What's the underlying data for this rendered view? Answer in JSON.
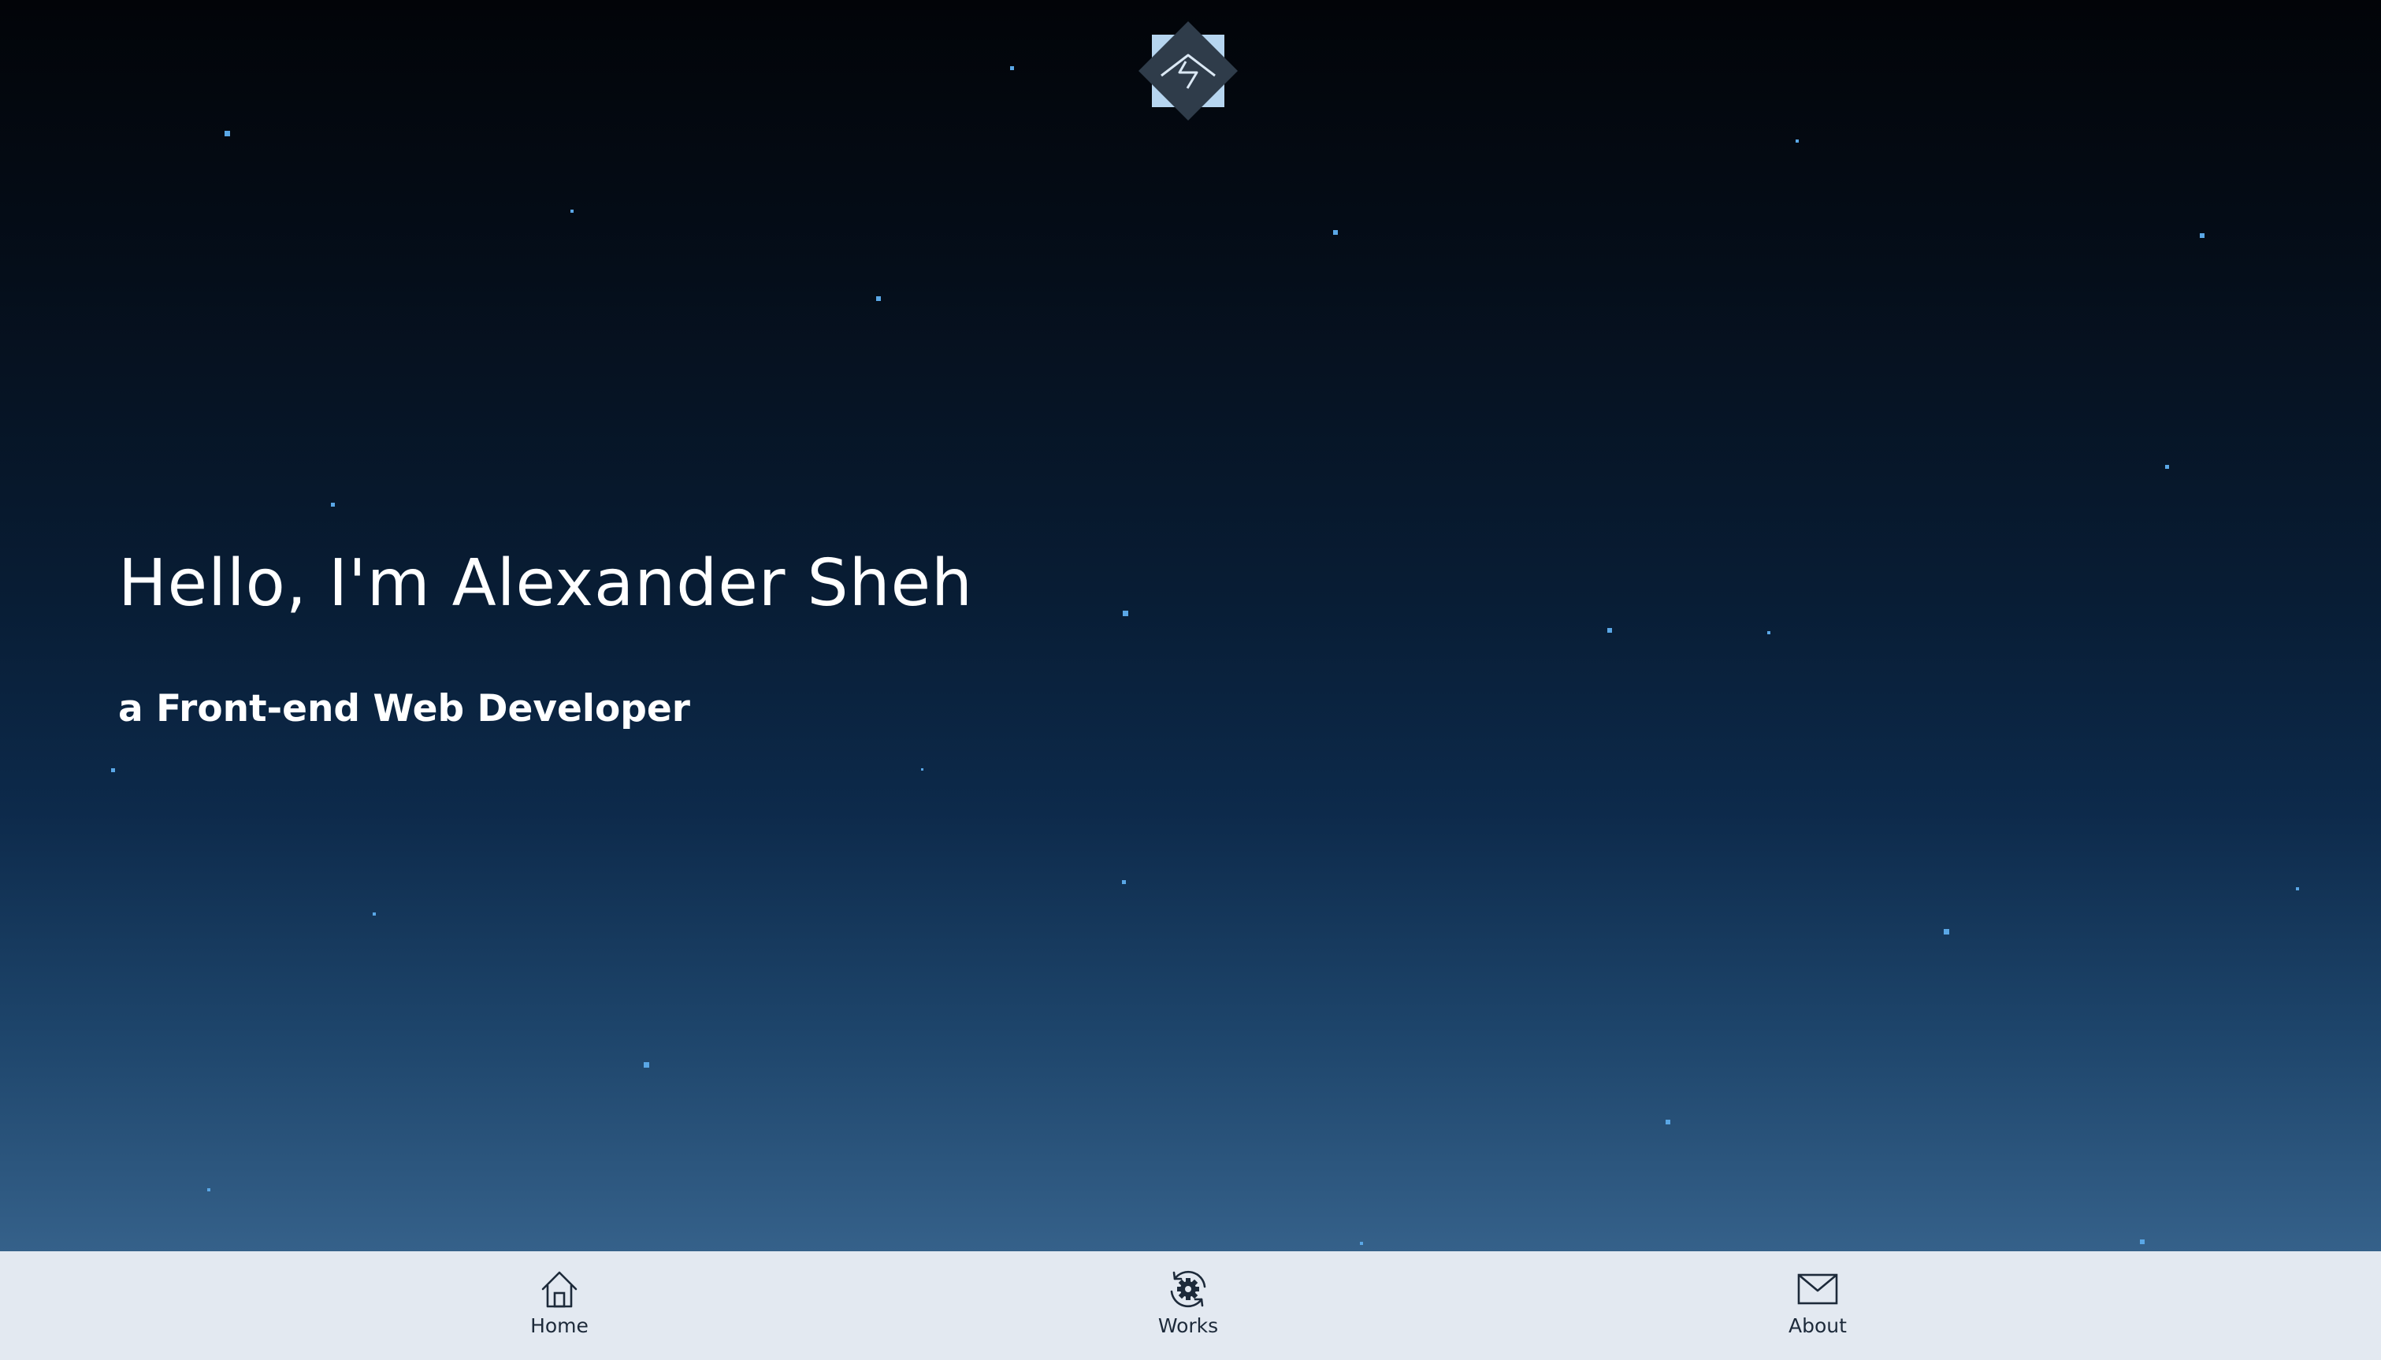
{
  "hero": {
    "title": "Hello, I'm Alexander Sheh",
    "subtitle": "a Front-end Web Developer"
  },
  "logo": {
    "icon": "diamond-bolt-logo-icon"
  },
  "nav": {
    "items": [
      {
        "label": "Home",
        "icon": "home-icon"
      },
      {
        "label": "Works",
        "icon": "gear-refresh-icon"
      },
      {
        "label": "About",
        "icon": "envelope-icon"
      }
    ]
  },
  "colors": {
    "sky_top": "#020408",
    "sky_bottom": "#35618a",
    "star": "#5aa7e6",
    "nav_bg": "#e3e9f1",
    "nav_text": "#1d2a3a",
    "logo_light": "#b6d5ef",
    "logo_dark": "#2f3c4a"
  }
}
